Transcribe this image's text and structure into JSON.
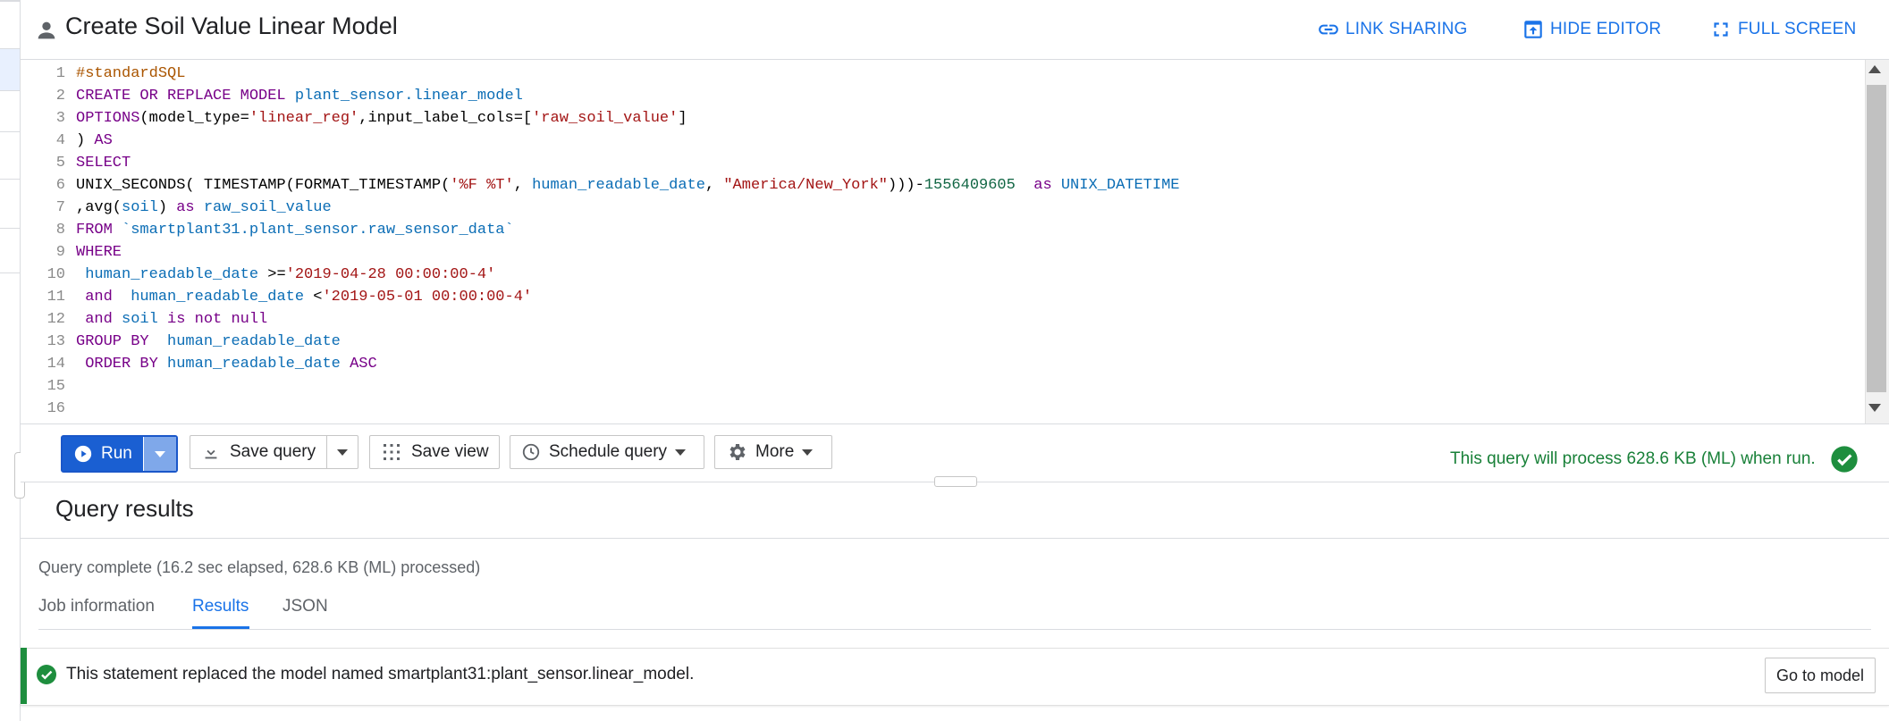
{
  "header": {
    "title": "Create Soil Value Linear Model",
    "link_sharing": "LINK SHARING",
    "hide_editor": "HIDE EDITOR",
    "full_screen": "FULL SCREEN",
    "accent_color": "#1a73e8"
  },
  "editor": {
    "line_numbers": [
      "1",
      "2",
      "3",
      "4",
      "5",
      "6",
      "7",
      "8",
      "9",
      "10",
      "11",
      "12",
      "13",
      "14",
      "15",
      "16"
    ],
    "lines": [
      [
        {
          "t": "#standardSQL",
          "c": "cmt"
        }
      ],
      [
        {
          "t": "CREATE OR REPLACE MODEL ",
          "c": "kw"
        },
        {
          "t": "plant_sensor.linear_model",
          "c": "id"
        }
      ],
      [
        {
          "t": "OPTIONS",
          "c": "kw"
        },
        {
          "t": "(model_type=",
          "c": ""
        },
        {
          "t": "'linear_reg'",
          "c": "str"
        },
        {
          "t": ",input_label_cols=[",
          "c": ""
        },
        {
          "t": "'raw_soil_value'",
          "c": "str"
        },
        {
          "t": "]",
          "c": ""
        }
      ],
      [
        {
          "t": ") ",
          "c": ""
        },
        {
          "t": "AS",
          "c": "kw"
        }
      ],
      [
        {
          "t": "SELECT",
          "c": "kw"
        }
      ],
      [
        {
          "t": "UNIX_SECONDS( TIMESTAMP(FORMAT_TIMESTAMP(",
          "c": ""
        },
        {
          "t": "'%F %T'",
          "c": "str"
        },
        {
          "t": ", ",
          "c": ""
        },
        {
          "t": "human_readable_date",
          "c": "id"
        },
        {
          "t": ", ",
          "c": ""
        },
        {
          "t": "\"America/New_York\"",
          "c": "str"
        },
        {
          "t": ")))-",
          "c": ""
        },
        {
          "t": "1556409605",
          "c": "num"
        },
        {
          "t": "  ",
          "c": ""
        },
        {
          "t": "as ",
          "c": "kw"
        },
        {
          "t": "UNIX_DATETIME",
          "c": "id"
        }
      ],
      [
        {
          "t": ",avg(",
          "c": ""
        },
        {
          "t": "soil",
          "c": "id"
        },
        {
          "t": ") ",
          "c": ""
        },
        {
          "t": "as ",
          "c": "kw"
        },
        {
          "t": "raw_soil_value",
          "c": "id"
        }
      ],
      [
        {
          "t": "FROM ",
          "c": "kw"
        },
        {
          "t": "`smartplant31.plant_sensor.raw_sensor_data`",
          "c": "id"
        }
      ],
      [
        {
          "t": "WHERE",
          "c": "kw"
        }
      ],
      [
        {
          "t": " human_readable_date ",
          "c": "id"
        },
        {
          "t": ">=",
          "c": ""
        },
        {
          "t": "'2019-04-28 00:00:00-4'",
          "c": "str"
        }
      ],
      [
        {
          "t": " and ",
          "c": "kw"
        },
        {
          "t": " human_readable_date ",
          "c": "id"
        },
        {
          "t": "<",
          "c": ""
        },
        {
          "t": "'2019-05-01 00:00:00-4'",
          "c": "str"
        }
      ],
      [
        {
          "t": " and ",
          "c": "kw"
        },
        {
          "t": "soil ",
          "c": "id"
        },
        {
          "t": "is not null",
          "c": "kw"
        }
      ],
      [
        {
          "t": "GROUP BY ",
          "c": "kw"
        },
        {
          "t": " human_readable_date",
          "c": "id"
        }
      ],
      [
        {
          "t": " ORDER BY ",
          "c": "kw"
        },
        {
          "t": "human_readable_date ",
          "c": "id"
        },
        {
          "t": "ASC",
          "c": "kw"
        }
      ],
      [],
      []
    ]
  },
  "toolbar": {
    "run_label": "Run",
    "save_query_label": "Save query",
    "save_view_label": "Save view",
    "schedule_query_label": "Schedule query",
    "more_label": "More",
    "validator_text": "This query will process 628.6 KB (ML) when run.",
    "validator_color": "#188038"
  },
  "results": {
    "title": "Query results",
    "status": "Query complete (16.2 sec elapsed, 628.6 KB (ML) processed)",
    "tabs": [
      {
        "label": "Job information"
      },
      {
        "label": "Results",
        "active": true
      },
      {
        "label": "JSON"
      }
    ],
    "notice_text": "This statement replaced the model named smartplant31:plant_sensor.linear_model.",
    "go_to_model_label": "Go to model"
  }
}
